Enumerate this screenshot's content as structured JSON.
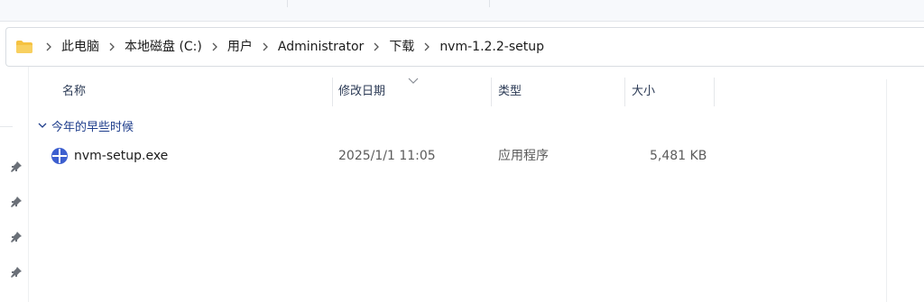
{
  "breadcrumb": {
    "items": [
      "此电脑",
      "本地磁盘 (C:)",
      "用户",
      "Administrator",
      "下载",
      "nvm-1.2.2-setup"
    ]
  },
  "columns": {
    "name": "名称",
    "date": "修改日期",
    "type": "类型",
    "size": "大小"
  },
  "group": {
    "label": "今年的早些时候"
  },
  "files": [
    {
      "name": "nvm-setup.exe",
      "date": "2025/1/1 11:05",
      "type": "应用程序",
      "size": "5,481 KB",
      "icon": "nvm-exe-icon"
    }
  ],
  "colors": {
    "folder": "#f5c242",
    "accent": "#1f3e8c",
    "exe_icon": "#3d5fcf"
  }
}
